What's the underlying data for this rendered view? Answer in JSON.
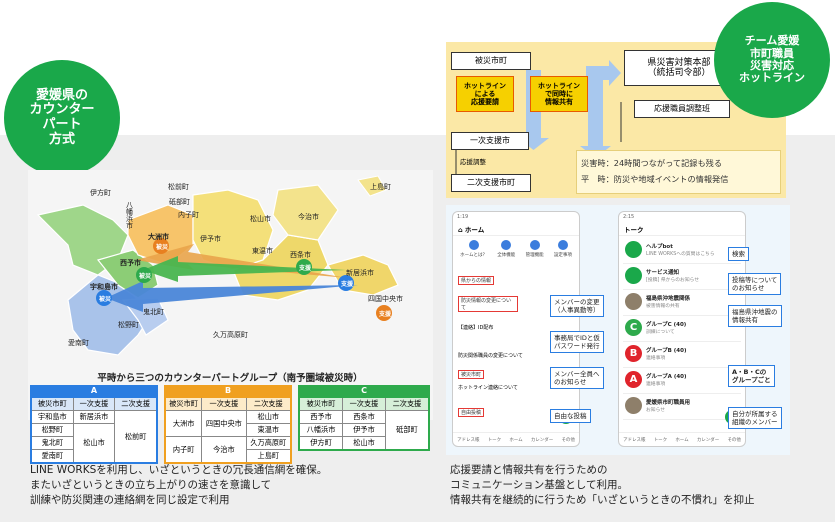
{
  "left_bubble": {
    "lines": [
      "愛媛県の",
      "カウンター",
      "パート",
      "方式"
    ],
    "color": "#1aa84a"
  },
  "right_bubble": {
    "lines": [
      "チーム愛媛",
      "市町職員",
      "災害対応",
      "ホットライン"
    ],
    "color": "#1aa84a"
  },
  "map": {
    "labels": {
      "ikata": "伊方町",
      "yawatahama": "八幡浜市",
      "ozu": "大洲市",
      "seiyo": "西予市",
      "uwajima": "宇和島市",
      "kihoku": "鬼北町",
      "matsuno": "松野町",
      "ainan": "愛南町",
      "matsumae": "松前町",
      "tobe": "砥部町",
      "uchiko": "内子町",
      "iyo": "伊予市",
      "matsuyama": "松山市",
      "toon": "東温市",
      "imabari": "今治市",
      "kamijima": "上島町",
      "saijo": "西条市",
      "niihama": "新居浜市",
      "shikokuchuo": "四国中央市",
      "kumakogen": "久万高原町"
    },
    "tags": {
      "hisai": "被災",
      "shien": "支援"
    },
    "subtitle": "平時から三つのカウンターパートグループ（南予圏域被災時）"
  },
  "groups": [
    {
      "name": "A",
      "color": "#2a7de1",
      "headers": [
        "被災市町",
        "一次支援",
        "二次支援"
      ],
      "rows": [
        [
          "宇和島市",
          "新居浜市",
          "松前町"
        ],
        [
          "松野町",
          "松山市",
          ""
        ],
        [
          "鬼北町",
          "",
          ""
        ],
        [
          "愛南町",
          "",
          ""
        ]
      ]
    },
    {
      "name": "B",
      "color": "#f0a020",
      "headers": [
        "被災市町",
        "一次支援",
        "二次支援"
      ],
      "rows": [
        [
          "大洲市",
          "四国中央市",
          "松山市"
        ],
        [
          "",
          "",
          "東温市"
        ],
        [
          "内子町",
          "今治市",
          "久万高原町"
        ],
        [
          "",
          "",
          "上島町"
        ]
      ]
    },
    {
      "name": "C",
      "color": "#2eaa4c",
      "headers": [
        "被災市町",
        "一次支援",
        "二次支援"
      ],
      "rows": [
        [
          "西予市",
          "西条市",
          ""
        ],
        [
          "八幡浜市",
          "伊予市",
          "砥部町"
        ],
        [
          "伊方町",
          "松山市",
          ""
        ]
      ]
    }
  ],
  "left_caption": [
    "LINE WORKSを利用し、いざというときの冗長通信網を確保。",
    "またいざというときの立ち上がりの速さを意識して",
    "訓練や防災関連の連絡網を同じ設定で利用"
  ],
  "flow": {
    "hisai": "被災市町",
    "hotline1": "ホットライン\nによる\n応援要請",
    "hotline2": "ホットライン\nで同時に\n情報共有",
    "pref": "県災害対策本部\n（統括司令部）",
    "ouen": "応援職員調整班",
    "ichiji": "一次支援市",
    "chosei": "応援調整",
    "niji": "二次支援市町",
    "note1": "災害時：24時間つながって記録も残る",
    "note2": "平　時：防災や地域イベントの情報発信"
  },
  "phone1": {
    "time": "1:19",
    "title": "ホーム",
    "icons": [
      "ホームとは？",
      "全体機能",
      "管理機能",
      "設定事項"
    ],
    "redlabels": [
      "県からの情報",
      "被災市町",
      "自由投稿"
    ],
    "items": [
      "防災情報の変更について",
      "【連絡】ID配布",
      "ホットライン連絡について",
      "防災関係職員の変更について"
    ],
    "tabs": [
      "アドレス帳",
      "トーク",
      "ホーム",
      "カレンダー",
      "その他"
    ]
  },
  "phone2": {
    "time": "2:15",
    "title": "トーク",
    "items": [
      {
        "name": "ヘルプbot",
        "sub": "LINE WORKSへの質問はこちら",
        "letter": "",
        "color": "#1aa84a"
      },
      {
        "name": "サービス通知",
        "sub": "[投稿] 県からのお知らせ",
        "letter": "",
        "color": "#1aa84a"
      },
      {
        "name": "福島県沖地震関係",
        "sub": "被害情報の共有",
        "letter": "",
        "color": "#8e7f6a"
      },
      {
        "name": "グループC (40)",
        "sub": "訓練について",
        "letter": "C",
        "color": "#2eaa4c"
      },
      {
        "name": "グループB (40)",
        "sub": "連絡事項",
        "letter": "B",
        "color": "#e0242c"
      },
      {
        "name": "グループA (40)",
        "sub": "連絡事項",
        "letter": "A",
        "color": "#e0242c"
      },
      {
        "name": "愛媛県市町職員用",
        "sub": "お知らせ",
        "letter": "",
        "color": "#8e7f6a"
      }
    ],
    "tabs": [
      "アドレス帳",
      "トーク",
      "ホーム",
      "カレンダー",
      "その他"
    ]
  },
  "callouts": {
    "member_change": "メンバーの変更\n（人事異動等）",
    "id_issue": "事務局でIDと仮\nパスワード発行",
    "notice_all": "メンバー全員へ\nのお知らせ",
    "free_post": "自由な投稿",
    "search": "検索",
    "post_notice": "投稿等について\nのお知らせ",
    "fukushima": "福島県沖地震の\n情報共有",
    "abc": "A・B・Cの\nグループごと",
    "own_org": "自分が所属する\n組織のメンバー"
  },
  "right_caption": [
    "応援要請と情報共有を行うための",
    "コミュニケーション基盤として利用。",
    "情報共有を継続的に行うため「いざというときの不慣れ」を抑止"
  ]
}
